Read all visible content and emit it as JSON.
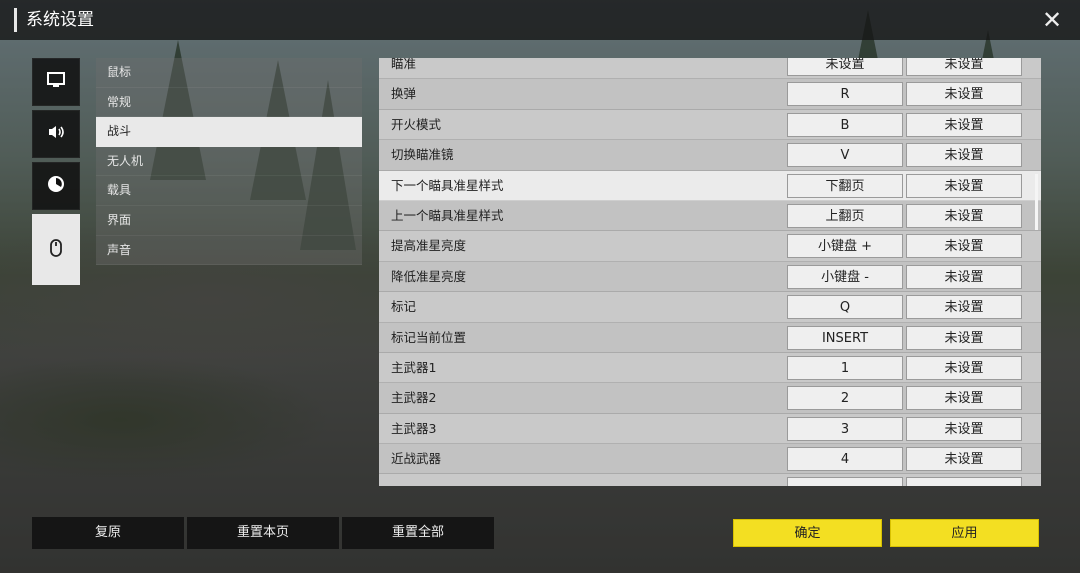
{
  "window": {
    "title": "系统设置",
    "close_glyph": "✕"
  },
  "sidebar": {
    "categories": [
      {
        "icon": "monitor-icon"
      },
      {
        "icon": "speaker-icon"
      },
      {
        "icon": "chart-icon"
      },
      {
        "icon": "mouse-icon",
        "selected": true
      }
    ]
  },
  "submenu": {
    "items": [
      "鼠标",
      "常规",
      "战斗",
      "无人机",
      "载具",
      "界面",
      "声音"
    ],
    "selected": "战斗"
  },
  "keybinds": {
    "rows": [
      {
        "action": "瞄准",
        "primary": "未设置",
        "secondary": "未设置"
      },
      {
        "action": "换弹",
        "primary": "R",
        "secondary": "未设置"
      },
      {
        "action": "开火模式",
        "primary": "B",
        "secondary": "未设置"
      },
      {
        "action": "切换瞄准镜",
        "primary": "V",
        "secondary": "未设置"
      },
      {
        "action": "下一个瞄具准星样式",
        "primary": "下翻页",
        "secondary": "未设置",
        "highlighted": true
      },
      {
        "action": "上一个瞄具准星样式",
        "primary": "上翻页",
        "secondary": "未设置"
      },
      {
        "action": "提高准星亮度",
        "primary": "小键盘 +",
        "secondary": "未设置"
      },
      {
        "action": "降低准星亮度",
        "primary": "小键盘 -",
        "secondary": "未设置"
      },
      {
        "action": "标记",
        "primary": "Q",
        "secondary": "未设置"
      },
      {
        "action": "标记当前位置",
        "primary": "INSERT",
        "secondary": "未设置"
      },
      {
        "action": "主武器1",
        "primary": "1",
        "secondary": "未设置"
      },
      {
        "action": "主武器2",
        "primary": "2",
        "secondary": "未设置"
      },
      {
        "action": "主武器3",
        "primary": "3",
        "secondary": "未设置"
      },
      {
        "action": "近战武器",
        "primary": "4",
        "secondary": "未设置"
      },
      {
        "action": "",
        "primary": "",
        "secondary": ""
      }
    ]
  },
  "footer": {
    "restore": "复原",
    "reset_page": "重置本页",
    "reset_all": "重置全部",
    "confirm": "确定",
    "apply": "应用"
  },
  "colors": {
    "accent_yellow": "#f3df22",
    "selected_bg": "#e9e9e9",
    "dark_button": "#121212"
  }
}
